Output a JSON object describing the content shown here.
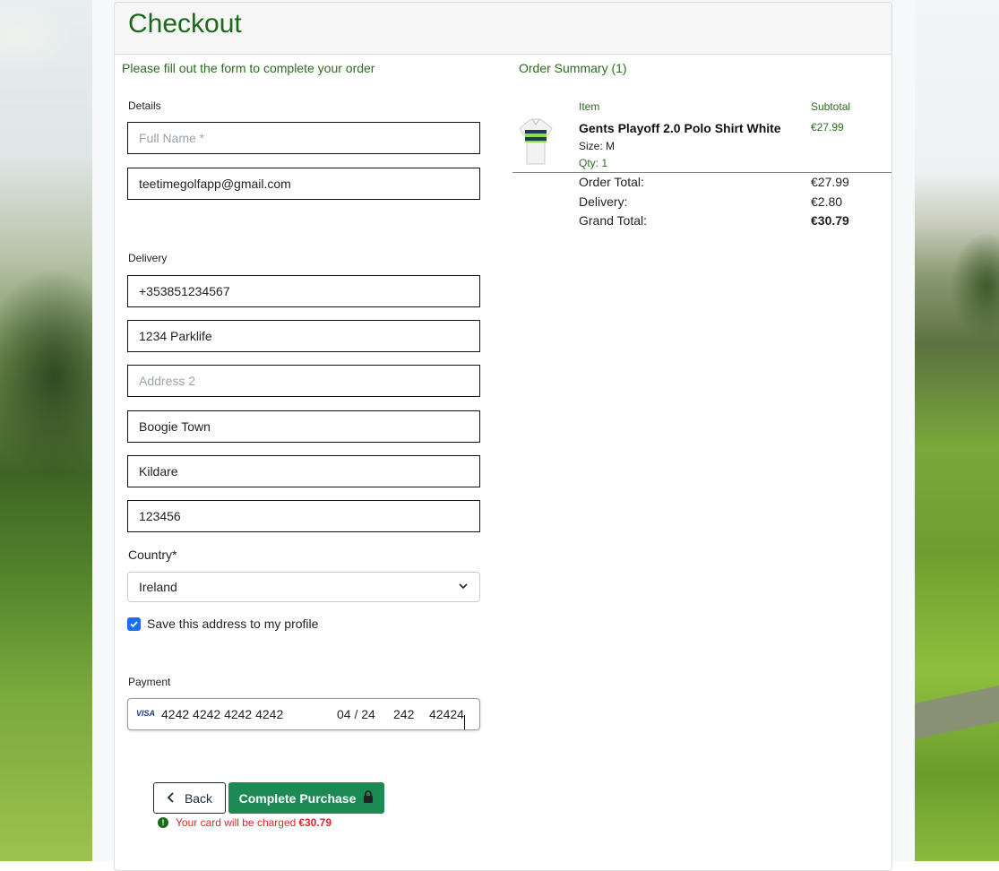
{
  "page": {
    "title": "Checkout",
    "intro": "Please fill out the form to complete your order"
  },
  "form": {
    "details_label": "Details",
    "full_name_placeholder": "Full Name *",
    "email": "teetimegolfapp@gmail.com",
    "delivery_label": "Delivery",
    "phone": "+353851234567",
    "address1": "1234 Parklife",
    "address2_placeholder": "Address 2",
    "town": "Boogie Town",
    "county": "Kildare",
    "postcode": "123456",
    "country_label": "Country*",
    "country_value": "Ireland",
    "save_address_label": "Save this address to my profile",
    "save_address_checked": true,
    "payment_label": "Payment",
    "card": {
      "brand": "VISA",
      "number": "4242 4242 4242 4242",
      "expiry": "04 / 24",
      "cvc": "242",
      "zip": "42424"
    }
  },
  "actions": {
    "back_label": "Back",
    "complete_label": "Complete Purchase",
    "charge_note": "Your card will be charged",
    "charge_amount": "€30.79"
  },
  "summary": {
    "title": "Order Summary (1)",
    "col_item": "Item",
    "col_subtotal": "Subtotal",
    "item": {
      "name": "Gents Playoff 2.0 Polo Shirt White",
      "size": "Size: M",
      "qty": "Qty: 1",
      "subtotal": "€27.99"
    },
    "order_total_label": "Order Total:",
    "order_total": "€27.99",
    "delivery_label": "Delivery:",
    "delivery": "€2.80",
    "grand_total_label": "Grand Total:",
    "grand_total": "€30.79"
  },
  "colors": {
    "brand_green": "#1a6a1a",
    "button_green": "#1d8a55",
    "error_red": "#d62b2b",
    "checkbox_blue": "#1a6ef0"
  }
}
